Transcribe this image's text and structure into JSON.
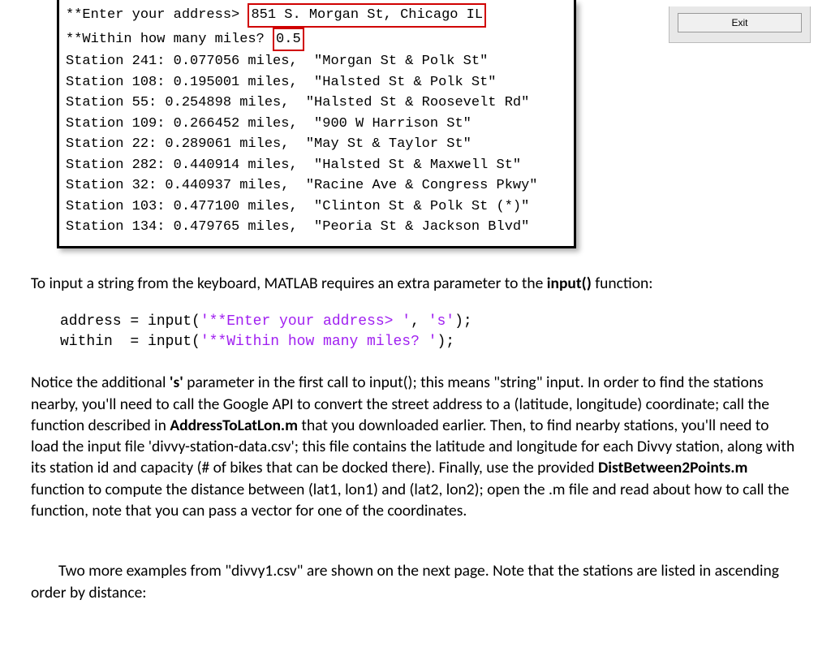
{
  "console": {
    "prompt1_label": "**Enter your address> ",
    "prompt1_value": "851 S. Morgan St, Chicago IL",
    "prompt2_label": "**Within how many miles? ",
    "prompt2_value": "0.5",
    "stations": [
      "Station 241: 0.077056 miles,  \"Morgan St & Polk St\"",
      "Station 108: 0.195001 miles,  \"Halsted St & Polk St\"",
      "Station 55: 0.254898 miles,  \"Halsted St & Roosevelt Rd\"",
      "Station 109: 0.266452 miles,  \"900 W Harrison St\"",
      "Station 22: 0.289061 miles,  \"May St & Taylor St\"",
      "Station 282: 0.440914 miles,  \"Halsted St & Maxwell St\"",
      "Station 32: 0.440937 miles,  \"Racine Ave & Congress Pkwy\"",
      "Station 103: 0.477100 miles,  \"Clinton St & Polk St (*)\"",
      "Station 134: 0.479765 miles,  \"Peoria St & Jackson Blvd\""
    ]
  },
  "exit_button": "Exit",
  "paragraphs": {
    "p1_a": "To input a string from the keyboard, MATLAB requires an extra parameter to the ",
    "p1_b": "input()",
    "p1_c": " function:",
    "code_line1_a": "address = input(",
    "code_line1_b": "'**Enter your address> '",
    "code_line1_c": ", ",
    "code_line1_d": "'s'",
    "code_line1_e": ");",
    "code_line2_a": "within  = input(",
    "code_line2_b": "'**Within how many miles? '",
    "code_line2_c": ");",
    "p2_a": "Notice the additional ",
    "p2_b": "'s'",
    "p2_c": " parameter in the first call to input(); this means \"string\" input.  In order to find the stations nearby, you'll need to call the Google API to convert the street address to a (latitude, longitude) coordinate; call the function described in ",
    "p2_d": "AddressToLatLon.m",
    "p2_e": " that you downloaded earlier.  Then, to find nearby stations, you'll need to load the input file 'divvy-station-data.csv'; this file contains the latitude and longitude for each Divvy station, along with its station id and capacity (# of bikes that can be docked there).  Finally, use the provided ",
    "p2_f": "DistBetween2Points.m",
    "p2_g": " function to compute the distance between (lat1, lon1) and (lat2, lon2); open the .m file and read about how to call the function, note that you can pass a vector for one of the coordinates.",
    "p3": "Two more examples from \"divvy1.csv\" are shown on the next page.  Note that the stations are listed in ascending order by distance:"
  }
}
